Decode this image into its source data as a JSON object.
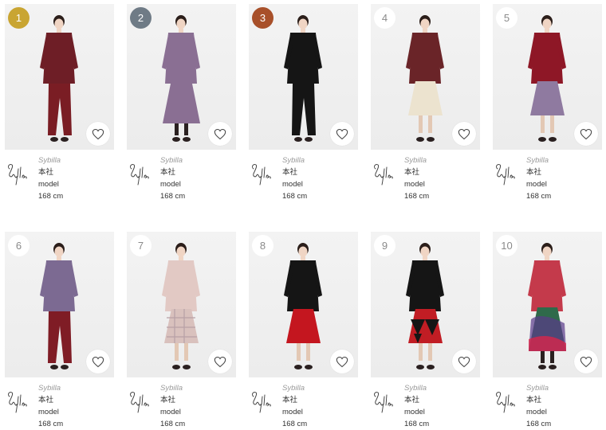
{
  "colors": {
    "rank_gold": "#c9a532",
    "rank_silver": "#6f7b86",
    "rank_bronze": "#a8502a",
    "photo_bg": "#efefef"
  },
  "icons": {
    "favorite": "heart-outline-icon",
    "brand_logo": "sybilla-signature-logo"
  },
  "items": [
    {
      "rank": "1",
      "brand": "Sybilla",
      "shop": "本社",
      "staff": "model",
      "height": "168 cm",
      "look": {
        "top": "#6e1e26",
        "bottom": "#7a1d24",
        "bottomType": "pants",
        "topType": "jacket",
        "pattern": ""
      }
    },
    {
      "rank": "2",
      "brand": "Sybilla",
      "shop": "本社",
      "staff": "model",
      "height": "168 cm",
      "look": {
        "top": "#8a6f93",
        "bottom": "#8a6f93",
        "bottomType": "longskirt",
        "topType": "coat",
        "pattern": ""
      }
    },
    {
      "rank": "3",
      "brand": "Sybilla",
      "shop": "本社",
      "staff": "model",
      "height": "168 cm",
      "look": {
        "top": "#151515",
        "bottom": "#151515",
        "bottomType": "pants",
        "topType": "jacket",
        "pattern": ""
      }
    },
    {
      "rank": "4",
      "brand": "Sybilla",
      "shop": "本社",
      "staff": "model",
      "height": "168 cm",
      "look": {
        "top": "#6a2428",
        "bottom": "#ece3cf",
        "bottomType": "skirt",
        "topType": "jacket",
        "pattern": ""
      }
    },
    {
      "rank": "5",
      "brand": "Sybilla",
      "shop": "本社",
      "staff": "model",
      "height": "168 cm",
      "look": {
        "top": "#8e1726",
        "bottom": "#8f7aa0",
        "bottomType": "skirt",
        "topType": "knit",
        "pattern": ""
      }
    },
    {
      "rank": "6",
      "brand": "Sybilla",
      "shop": "本社",
      "staff": "model",
      "height": "168 cm",
      "look": {
        "top": "#7c6a92",
        "bottom": "#7f1c25",
        "bottomType": "pants",
        "topType": "jacket",
        "pattern": ""
      }
    },
    {
      "rank": "7",
      "brand": "Sybilla",
      "shop": "本社",
      "staff": "model",
      "height": "168 cm",
      "look": {
        "top": "#e2c9c4",
        "bottom": "#d9c1bd",
        "bottomType": "skirt",
        "topType": "blouse",
        "pattern": "check"
      }
    },
    {
      "rank": "8",
      "brand": "Sybilla",
      "shop": "本社",
      "staff": "model",
      "height": "168 cm",
      "look": {
        "top": "#151515",
        "bottom": "#c4161f",
        "bottomType": "skirt",
        "topType": "knit",
        "pattern": ""
      }
    },
    {
      "rank": "9",
      "brand": "Sybilla",
      "shop": "本社",
      "staff": "model",
      "height": "168 cm",
      "look": {
        "top": "#151515",
        "bottom": "#c11d24",
        "bottomType": "skirt",
        "topType": "knit",
        "pattern": "triangle"
      }
    },
    {
      "rank": "10",
      "brand": "Sybilla",
      "shop": "本社",
      "staff": "model",
      "height": "168 cm",
      "look": {
        "top": "#c43a4b",
        "bottom": "#2f6a4a",
        "bottomType": "longskirt",
        "topType": "blouse",
        "pattern": "abstract"
      }
    }
  ]
}
